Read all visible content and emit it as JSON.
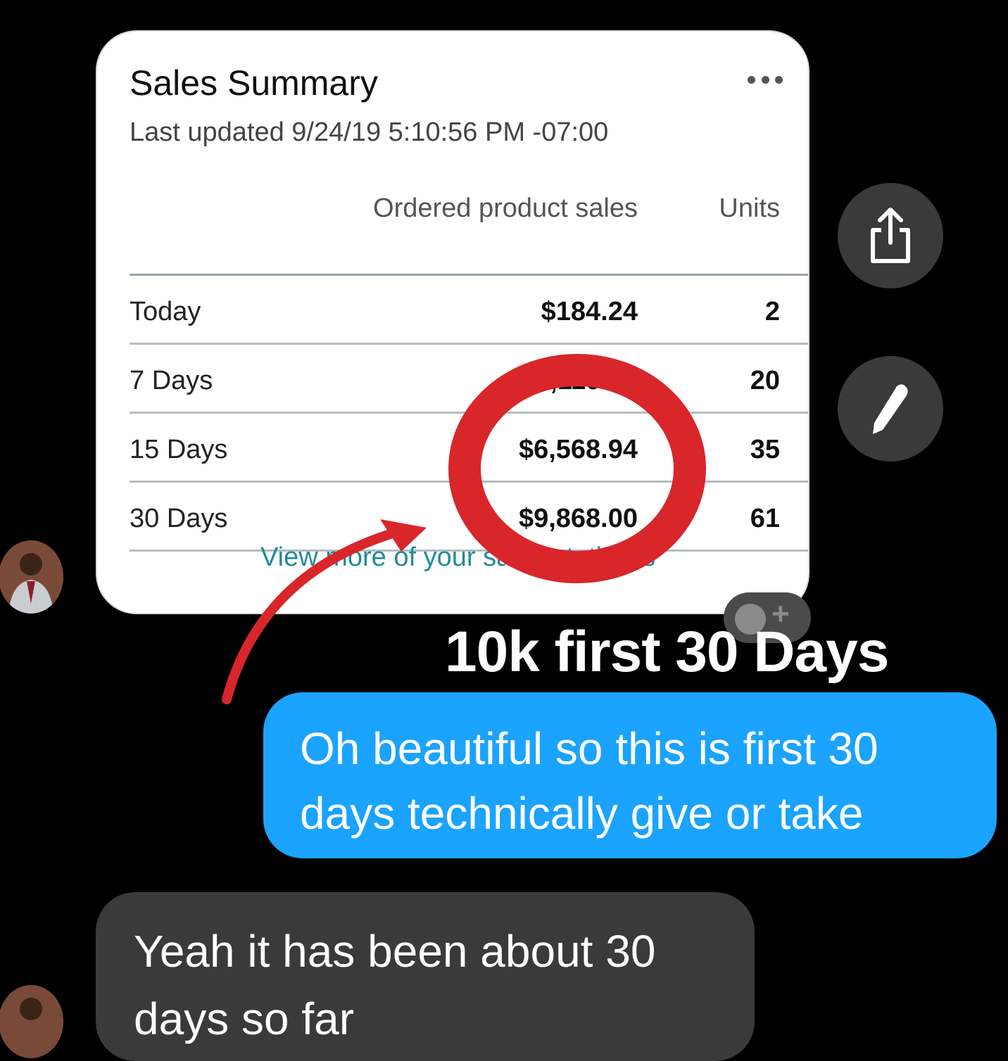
{
  "card": {
    "title": "Sales Summary",
    "updated": "Last updated 9/24/19 5:10:56 PM -07:00",
    "menu_icon": "more-horizontal-icon",
    "columns": [
      "Ordered product sales",
      "Units"
    ],
    "rows": [
      {
        "label": "Today",
        "sales": "$184.24",
        "units": "2"
      },
      {
        "label": "7 Days",
        "sales": "$4,110.83",
        "units": "20"
      },
      {
        "label": "15 Days",
        "sales": "$6,568.94",
        "units": "35"
      },
      {
        "label": "30 Days",
        "sales": "$9,868.00",
        "units": "61"
      }
    ],
    "link_text": "View more of your sales statistics"
  },
  "actions": {
    "share_icon": "share-icon",
    "edit_icon": "pencil-icon",
    "react_icon": "add-reaction-icon"
  },
  "annotation": {
    "caption": "10k first 30 Days",
    "color": "#d8262a"
  },
  "messages": [
    {
      "sender": "me",
      "text": "Oh beautiful so this is first 30 days technically give or take",
      "color": "#1aa3ff"
    },
    {
      "sender": "other",
      "text": "Yeah it has been about 30 days so far",
      "color": "#3a3a3a"
    }
  ]
}
